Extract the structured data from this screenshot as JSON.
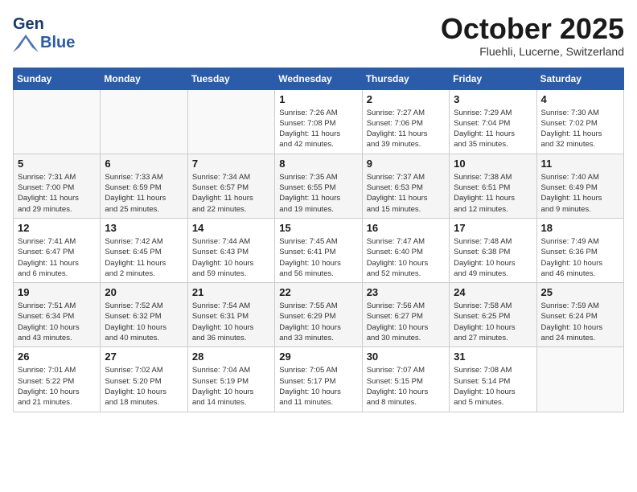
{
  "header": {
    "logo_general": "General",
    "logo_blue": "Blue",
    "month": "October 2025",
    "location": "Fluehli, Lucerne, Switzerland"
  },
  "weekdays": [
    "Sunday",
    "Monday",
    "Tuesday",
    "Wednesday",
    "Thursday",
    "Friday",
    "Saturday"
  ],
  "weeks": [
    [
      {
        "day": "",
        "info": ""
      },
      {
        "day": "",
        "info": ""
      },
      {
        "day": "",
        "info": ""
      },
      {
        "day": "1",
        "info": "Sunrise: 7:26 AM\nSunset: 7:08 PM\nDaylight: 11 hours\nand 42 minutes."
      },
      {
        "day": "2",
        "info": "Sunrise: 7:27 AM\nSunset: 7:06 PM\nDaylight: 11 hours\nand 39 minutes."
      },
      {
        "day": "3",
        "info": "Sunrise: 7:29 AM\nSunset: 7:04 PM\nDaylight: 11 hours\nand 35 minutes."
      },
      {
        "day": "4",
        "info": "Sunrise: 7:30 AM\nSunset: 7:02 PM\nDaylight: 11 hours\nand 32 minutes."
      }
    ],
    [
      {
        "day": "5",
        "info": "Sunrise: 7:31 AM\nSunset: 7:00 PM\nDaylight: 11 hours\nand 29 minutes."
      },
      {
        "day": "6",
        "info": "Sunrise: 7:33 AM\nSunset: 6:59 PM\nDaylight: 11 hours\nand 25 minutes."
      },
      {
        "day": "7",
        "info": "Sunrise: 7:34 AM\nSunset: 6:57 PM\nDaylight: 11 hours\nand 22 minutes."
      },
      {
        "day": "8",
        "info": "Sunrise: 7:35 AM\nSunset: 6:55 PM\nDaylight: 11 hours\nand 19 minutes."
      },
      {
        "day": "9",
        "info": "Sunrise: 7:37 AM\nSunset: 6:53 PM\nDaylight: 11 hours\nand 15 minutes."
      },
      {
        "day": "10",
        "info": "Sunrise: 7:38 AM\nSunset: 6:51 PM\nDaylight: 11 hours\nand 12 minutes."
      },
      {
        "day": "11",
        "info": "Sunrise: 7:40 AM\nSunset: 6:49 PM\nDaylight: 11 hours\nand 9 minutes."
      }
    ],
    [
      {
        "day": "12",
        "info": "Sunrise: 7:41 AM\nSunset: 6:47 PM\nDaylight: 11 hours\nand 6 minutes."
      },
      {
        "day": "13",
        "info": "Sunrise: 7:42 AM\nSunset: 6:45 PM\nDaylight: 11 hours\nand 2 minutes."
      },
      {
        "day": "14",
        "info": "Sunrise: 7:44 AM\nSunset: 6:43 PM\nDaylight: 10 hours\nand 59 minutes."
      },
      {
        "day": "15",
        "info": "Sunrise: 7:45 AM\nSunset: 6:41 PM\nDaylight: 10 hours\nand 56 minutes."
      },
      {
        "day": "16",
        "info": "Sunrise: 7:47 AM\nSunset: 6:40 PM\nDaylight: 10 hours\nand 52 minutes."
      },
      {
        "day": "17",
        "info": "Sunrise: 7:48 AM\nSunset: 6:38 PM\nDaylight: 10 hours\nand 49 minutes."
      },
      {
        "day": "18",
        "info": "Sunrise: 7:49 AM\nSunset: 6:36 PM\nDaylight: 10 hours\nand 46 minutes."
      }
    ],
    [
      {
        "day": "19",
        "info": "Sunrise: 7:51 AM\nSunset: 6:34 PM\nDaylight: 10 hours\nand 43 minutes."
      },
      {
        "day": "20",
        "info": "Sunrise: 7:52 AM\nSunset: 6:32 PM\nDaylight: 10 hours\nand 40 minutes."
      },
      {
        "day": "21",
        "info": "Sunrise: 7:54 AM\nSunset: 6:31 PM\nDaylight: 10 hours\nand 36 minutes."
      },
      {
        "day": "22",
        "info": "Sunrise: 7:55 AM\nSunset: 6:29 PM\nDaylight: 10 hours\nand 33 minutes."
      },
      {
        "day": "23",
        "info": "Sunrise: 7:56 AM\nSunset: 6:27 PM\nDaylight: 10 hours\nand 30 minutes."
      },
      {
        "day": "24",
        "info": "Sunrise: 7:58 AM\nSunset: 6:25 PM\nDaylight: 10 hours\nand 27 minutes."
      },
      {
        "day": "25",
        "info": "Sunrise: 7:59 AM\nSunset: 6:24 PM\nDaylight: 10 hours\nand 24 minutes."
      }
    ],
    [
      {
        "day": "26",
        "info": "Sunrise: 7:01 AM\nSunset: 5:22 PM\nDaylight: 10 hours\nand 21 minutes."
      },
      {
        "day": "27",
        "info": "Sunrise: 7:02 AM\nSunset: 5:20 PM\nDaylight: 10 hours\nand 18 minutes."
      },
      {
        "day": "28",
        "info": "Sunrise: 7:04 AM\nSunset: 5:19 PM\nDaylight: 10 hours\nand 14 minutes."
      },
      {
        "day": "29",
        "info": "Sunrise: 7:05 AM\nSunset: 5:17 PM\nDaylight: 10 hours\nand 11 minutes."
      },
      {
        "day": "30",
        "info": "Sunrise: 7:07 AM\nSunset: 5:15 PM\nDaylight: 10 hours\nand 8 minutes."
      },
      {
        "day": "31",
        "info": "Sunrise: 7:08 AM\nSunset: 5:14 PM\nDaylight: 10 hours\nand 5 minutes."
      },
      {
        "day": "",
        "info": ""
      }
    ]
  ]
}
